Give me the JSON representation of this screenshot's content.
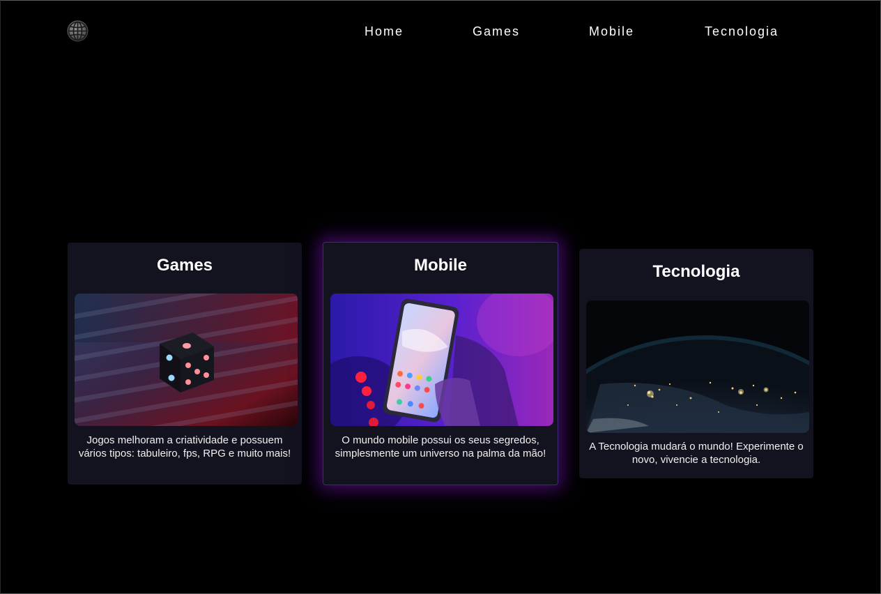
{
  "header": {
    "logo_icon": "globe-icon",
    "nav": [
      {
        "label": "Home"
      },
      {
        "label": "Games"
      },
      {
        "label": "Mobile"
      },
      {
        "label": "Tecnologia"
      }
    ]
  },
  "cards": [
    {
      "title": "Games",
      "image": "dice-photo",
      "text": "Jogos melhoram a criatividade e possuem vários tipos: tabuleiro, fps, RPG e muito mais!"
    },
    {
      "title": "Mobile",
      "image": "smartphone-photo",
      "text": "O mundo mobile possui os seus segredos, simplesmente um universo na palma da mão!"
    },
    {
      "title": "Tecnologia",
      "image": "earth-at-night-photo",
      "text": "A Tecnologia mudará o mundo! Experimente o novo, vivencie a tecnologia."
    }
  ],
  "colors": {
    "background": "#000000",
    "card_background": "#13121f",
    "highlight_glow": "#6014a0",
    "text": "#ffffff"
  }
}
